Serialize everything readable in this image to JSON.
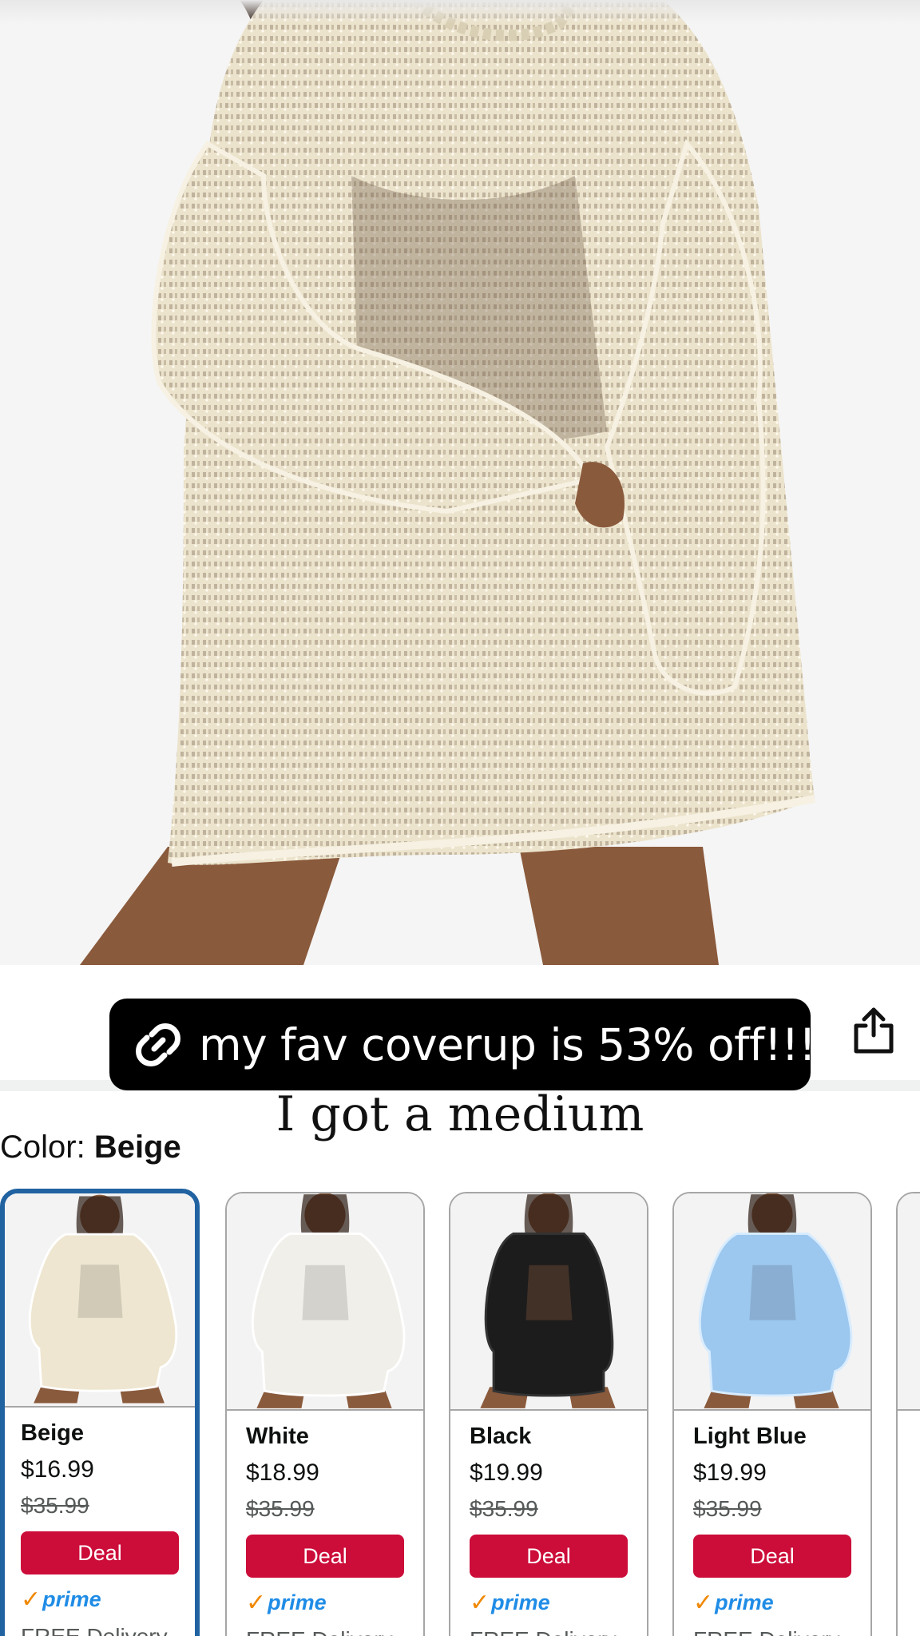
{
  "overlay": {
    "caption": "my fav coverup is 53% off!!!",
    "subcaption": "I got a medium"
  },
  "product": {
    "color_prefix": "Color: ",
    "selected_color": "Beige",
    "variants": [
      {
        "name": "Beige",
        "price": "$16.99",
        "list_price": "$35.99",
        "deal_label": "Deal",
        "prime_label": "prime",
        "delivery": "FREE Delivery",
        "fabric": "#eee6d0",
        "selected": true
      },
      {
        "name": "White",
        "price": "$18.99",
        "list_price": "$35.99",
        "deal_label": "Deal",
        "prime_label": "prime",
        "delivery": "FREE Delivery",
        "fabric": "#f1efe9",
        "selected": false
      },
      {
        "name": "Black",
        "price": "$19.99",
        "list_price": "$35.99",
        "deal_label": "Deal",
        "prime_label": "prime",
        "delivery": "FREE Delivery",
        "fabric": "#1c1c1c",
        "selected": false
      },
      {
        "name": "Light Blue",
        "price": "$19.99",
        "list_price": "$35.99",
        "deal_label": "Deal",
        "prime_label": "prime",
        "delivery": "FREE Delivery",
        "fabric": "#9cc7ee",
        "selected": false
      }
    ]
  },
  "colors": {
    "deal_red": "#cc0c39",
    "prime_blue": "#1f8ce6",
    "prime_check": "#f08804",
    "selected_border": "#2162a1",
    "hero_fabric": "#eee6d0",
    "skin": "#8a5a3c"
  },
  "icons": {
    "caption_icon": "link-icon",
    "share_icon": "share-icon",
    "prime_check_icon": "check-icon"
  }
}
